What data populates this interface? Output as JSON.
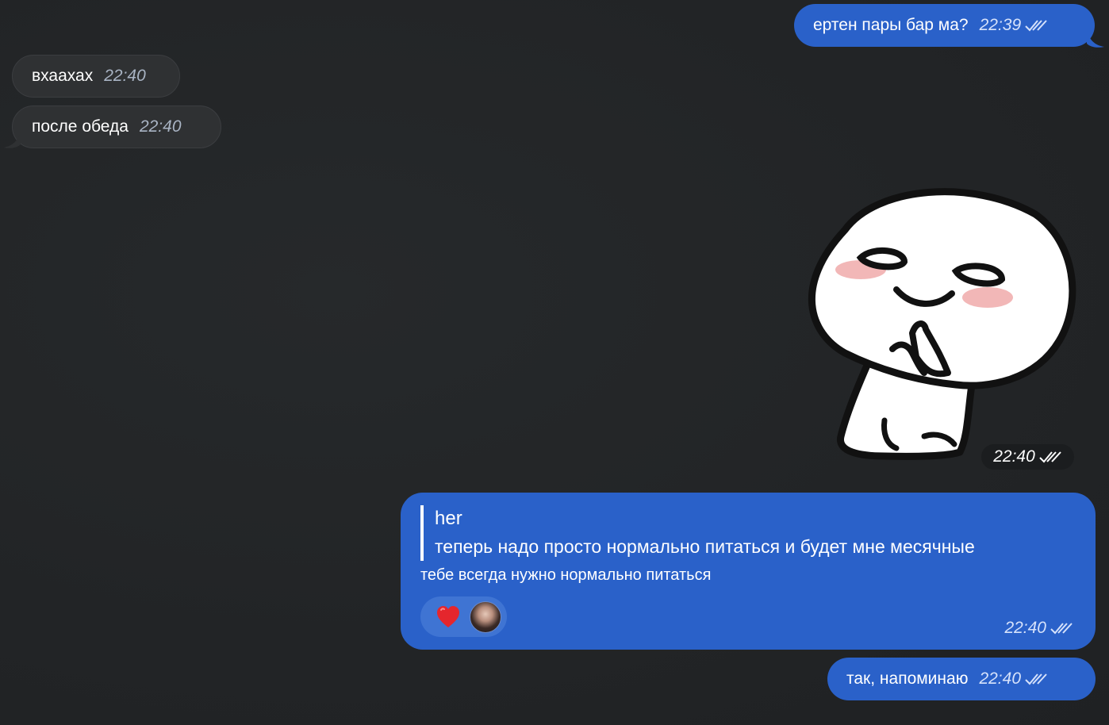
{
  "messages": {
    "m1": {
      "text": "ертен пары бар ма?",
      "time": "22:39",
      "status": "read"
    },
    "m2": {
      "text": "вхаахах",
      "time": "22:40"
    },
    "m3": {
      "text": "после обеда",
      "time": "22:40"
    },
    "m4": {
      "type": "sticker",
      "time": "22:40",
      "status": "read"
    },
    "m5": {
      "reply_to": {
        "author": "her",
        "text": "теперь надо просто нормально питаться и будет мне месячные"
      },
      "text": "тебе всегда нужно нормально питаться",
      "reaction": "❤️",
      "time": "22:40",
      "status": "read"
    },
    "m6": {
      "text": "так, напоминаю",
      "time": "22:40",
      "status": "read"
    }
  },
  "colors": {
    "background": "#222426",
    "outgoing_bubble": "#2a61c9",
    "incoming_bubble": "#2f3133"
  },
  "icons": {
    "read_status": "double-check-icon",
    "reaction": "heart-icon"
  }
}
